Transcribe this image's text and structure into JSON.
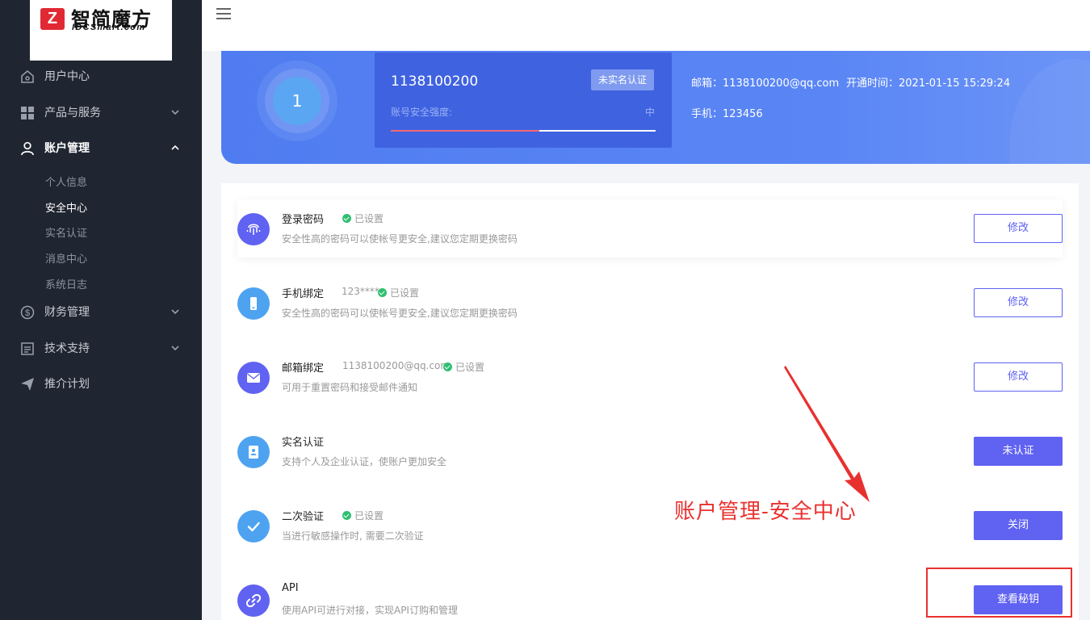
{
  "brand": {
    "name_cn": "智简魔方",
    "name_en": "IDCSmart.com",
    "mark": "Z"
  },
  "sidebar": {
    "items": [
      {
        "label": "用户中心",
        "icon": "home-icon"
      },
      {
        "label": "产品与服务",
        "icon": "grid-icon"
      },
      {
        "label": "账户管理",
        "icon": "user-icon"
      },
      {
        "label": "财务管理",
        "icon": "dollar-icon"
      },
      {
        "label": "技术支持",
        "icon": "document-icon"
      },
      {
        "label": "推介计划",
        "icon": "paper-plane-icon"
      }
    ],
    "account_submenu": [
      "个人信息",
      "安全中心",
      "实名认证",
      "消息中心",
      "系统日志"
    ]
  },
  "banner": {
    "avatar_text": "1",
    "account_id": "1138100200",
    "verify_badge": "未实名认证",
    "security_label": "账号安全强度:",
    "security_level": "中",
    "security_fill": 0.56,
    "email_label": "邮箱：",
    "email": "1138100200@qq.com",
    "open_time_label": "开通时间：",
    "open_time": "2021-01-15 15:29:24",
    "phone_label": "手机：",
    "phone": "123456"
  },
  "security": {
    "rows": [
      {
        "title": "登录密码",
        "extra": "",
        "status": "已设置",
        "desc": "安全性高的密码可以使帐号更安全,建议您定期更换密码",
        "button": "修改",
        "icon": "fingerprint-icon"
      },
      {
        "title": "手机绑定",
        "extra": "123****",
        "status": "已设置",
        "desc": "安全性高的密码可以使帐号更安全,建议您定期更换密码",
        "button": "修改",
        "icon": "phone-icon"
      },
      {
        "title": "邮箱绑定",
        "extra": "1138100200@qq.com",
        "status": "已设置",
        "desc": "可用于重置密码和接受邮件通知",
        "button": "修改",
        "icon": "mail-icon"
      },
      {
        "title": "实名认证",
        "extra": "",
        "status": "",
        "desc": "支持个人及企业认证，使账户更加安全",
        "button": "未认证",
        "icon": "id-card-icon"
      },
      {
        "title": "二次验证",
        "extra": "",
        "status": "已设置",
        "desc": "当进行敏感操作时, 需要二次验证",
        "button": "关闭",
        "icon": "checkmark-icon"
      },
      {
        "title": "API",
        "extra": "",
        "status": "",
        "desc": "使用API可进行对接，实现API订购和管理",
        "button": "查看秘钥",
        "icon": "link-icon"
      }
    ]
  },
  "annotation": {
    "text": "账户管理-安全中心"
  },
  "colors": {
    "sidebar_bg": "#202631",
    "accent": "#6062f2",
    "banner_blue": "#5a86f5",
    "success": "#2fbf71",
    "annotation_red": "#e8312f"
  }
}
